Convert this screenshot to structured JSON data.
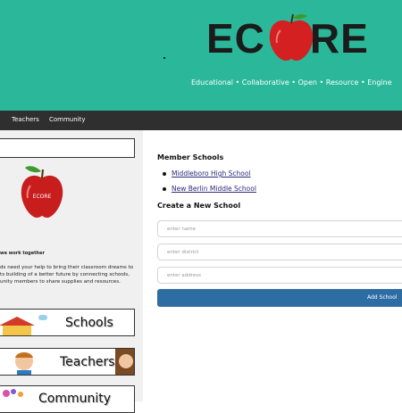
{
  "header": {
    "logo_text": "ECORE",
    "tagline": "Educational • Collaborative • Open • Resource • Engine"
  },
  "nav": {
    "items": [
      {
        "label": "Teachers"
      },
      {
        "label": "Community"
      }
    ]
  },
  "sidebar": {
    "apple_label": "ECORE",
    "heading": "we work together",
    "text": "ds need your help to bring their classroom dreams to ts building of a better future by connecting schools, unity members to share supplies and resources.",
    "banners": [
      {
        "label": "Schools"
      },
      {
        "label": "Teachers"
      },
      {
        "label": "Community"
      }
    ]
  },
  "main": {
    "member_title": "Member Schools",
    "schools": [
      {
        "name": "Middleboro High School"
      },
      {
        "name": "New Berlin Middle School"
      }
    ],
    "create_title": "Create a New School",
    "fields": {
      "name_placeholder": "enter name",
      "district_placeholder": "enter district",
      "address_placeholder": "enter address"
    },
    "add_button": "Add School"
  },
  "colors": {
    "header_bg": "#2bb89a",
    "nav_bg": "#2f2f2f",
    "button_bg": "#2e6da4",
    "apple_red": "#d42020"
  }
}
